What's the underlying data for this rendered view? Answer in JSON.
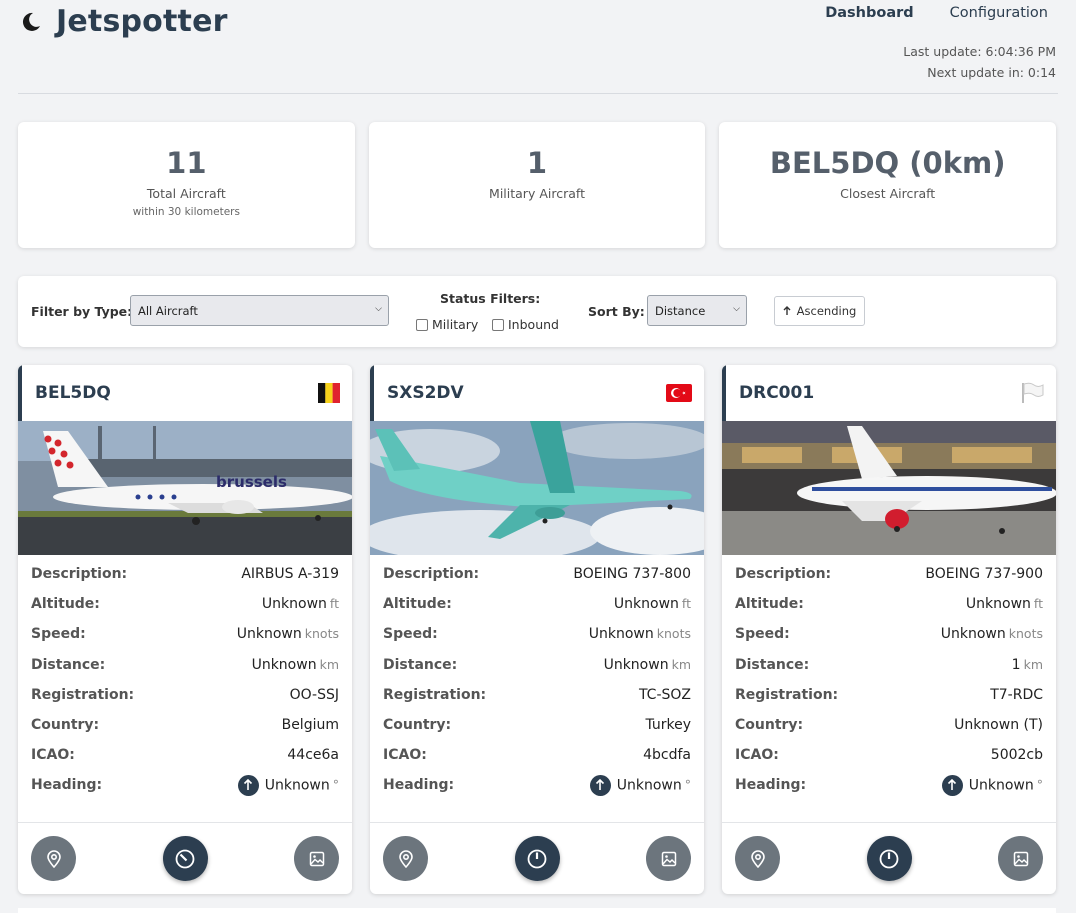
{
  "app": {
    "title": "Jetspotter",
    "brand_icon": "moon-icon"
  },
  "nav": {
    "dashboard": "Dashboard",
    "configuration": "Configuration"
  },
  "timing": {
    "last_update": "Last update: 6:04:36 PM",
    "next_update": "Next update in: 0:14"
  },
  "stats": [
    {
      "value": "11",
      "label": "Total Aircraft",
      "sub": "within 30 kilometers"
    },
    {
      "value": "1",
      "label": "Military Aircraft"
    },
    {
      "value": "BEL5DQ (0km)",
      "label": "Closest Aircraft"
    }
  ],
  "filters": {
    "type_label": "Filter by Type:",
    "type_value": "All Aircraft",
    "status_label": "Status Filters:",
    "military_label": "Military",
    "inbound_label": "Inbound",
    "sort_label": "Sort By:",
    "sort_value": "Distance",
    "order_label": "Ascending"
  },
  "labels": {
    "description": "Description:",
    "altitude": "Altitude:",
    "speed": "Speed:",
    "distance": "Distance:",
    "registration": "Registration:",
    "country": "Country:",
    "icao": "ICAO:",
    "heading": "Heading:"
  },
  "units": {
    "altitude": "ft",
    "speed": "knots",
    "distance": "km",
    "heading": "°"
  },
  "aircraft": [
    {
      "callsign": "BEL5DQ",
      "flag": "belgium-flag-icon",
      "description": "AIRBUS A-319",
      "altitude": "Unknown",
      "speed": "Unknown",
      "distance": "Unknown",
      "registration": "OO-SSJ",
      "country": "Belgium",
      "icao": "44ce6a",
      "heading": "Unknown"
    },
    {
      "callsign": "SXS2DV",
      "flag": "turkey-flag-icon",
      "description": "BOEING 737-800",
      "altitude": "Unknown",
      "speed": "Unknown",
      "distance": "Unknown",
      "registration": "TC-SOZ",
      "country": "Turkey",
      "icao": "4bcdfa",
      "heading": "Unknown"
    },
    {
      "callsign": "DRC001",
      "flag": "white-flag-icon",
      "description": "BOEING 737-900",
      "altitude": "Unknown",
      "speed": "Unknown",
      "distance": "1",
      "registration": "T7-RDC",
      "country": "Unknown (T)",
      "icao": "5002cb",
      "heading": "Unknown"
    }
  ],
  "colors": {
    "primary": "#2c3e50",
    "secondary_button": "#6c757d",
    "background": "#f2f3f5"
  }
}
